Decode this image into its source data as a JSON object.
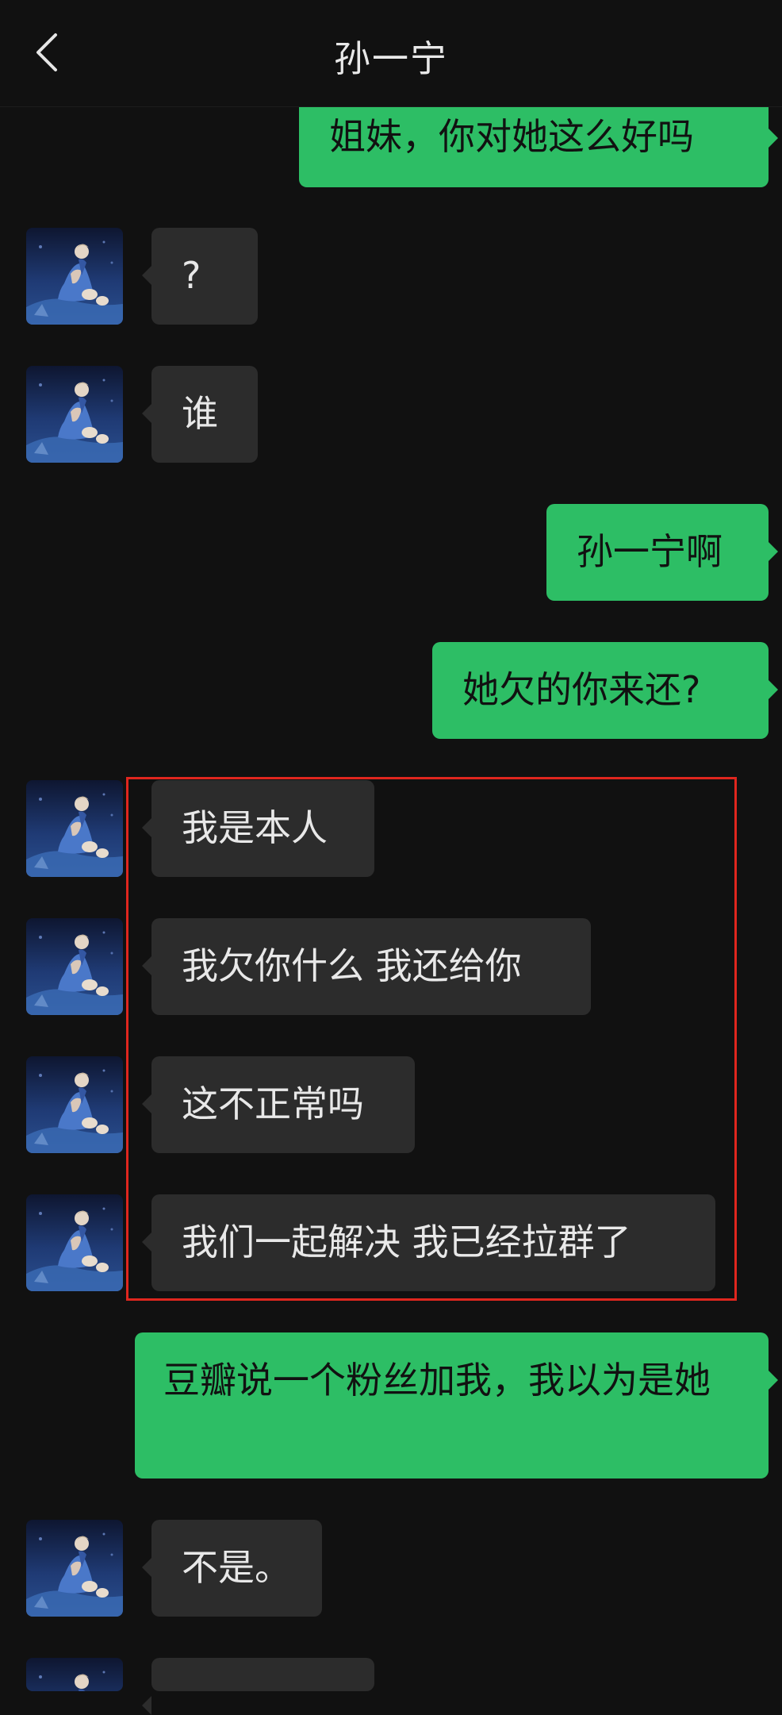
{
  "header": {
    "title": "孙一宁"
  },
  "colors": {
    "background": "#111111",
    "sent_bubble": "#2dbe65",
    "received_bubble": "#2c2c2c",
    "highlight": "#e0261e"
  },
  "messages": [
    {
      "side": "sent",
      "text": "姐妹，你对她这么好吗"
    },
    {
      "side": "received",
      "text": "?"
    },
    {
      "side": "received",
      "text": "谁"
    },
    {
      "side": "sent",
      "text": "孙一宁啊"
    },
    {
      "side": "sent",
      "text": "她欠的你来还?"
    },
    {
      "side": "received",
      "text": "我是本人"
    },
    {
      "side": "received",
      "text": "我欠你什么 我还给你"
    },
    {
      "side": "received",
      "text": "这不正常吗"
    },
    {
      "side": "received",
      "text": "我们一起解决 我已经拉群了"
    },
    {
      "side": "sent",
      "text": "豆瓣说一个粉丝加我，我以为是她"
    },
    {
      "side": "received",
      "text": "不是。"
    }
  ]
}
